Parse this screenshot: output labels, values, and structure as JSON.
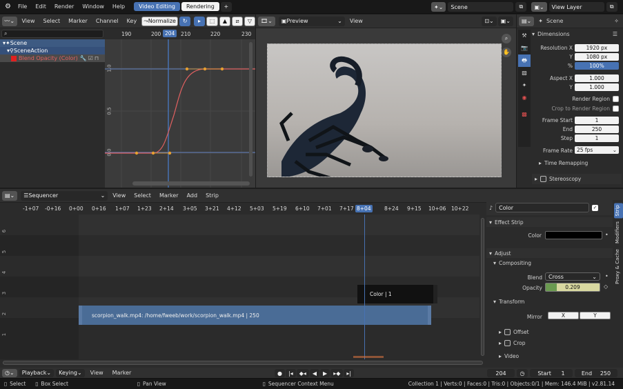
{
  "topbar": {
    "menus": [
      "File",
      "Edit",
      "Render",
      "Window",
      "Help"
    ],
    "workspaces": [
      "Video Editing",
      "Rendering"
    ],
    "scene": "Scene",
    "view_layer": "View Layer"
  },
  "graph_editor": {
    "menus": [
      "View",
      "Select",
      "Marker",
      "Channel",
      "Key"
    ],
    "normalize": "Normalize",
    "ruler": [
      "190",
      "200",
      "204",
      "210",
      "220",
      "230"
    ],
    "current_frame": "204",
    "tree": [
      "Scene",
      "SceneAction",
      "Blend Opacity (Color)"
    ],
    "y_labels": [
      "1.0",
      "0.5",
      "0.0"
    ]
  },
  "preview": {
    "mode": "Preview",
    "view_menu": "View"
  },
  "properties": {
    "scene_label": "Scene",
    "section": "Dimensions",
    "resolution_x_label": "Resolution X",
    "resolution_x": "1920 px",
    "y_label": "Y",
    "resolution_y": "1080 px",
    "pct_label": "%",
    "pct": "100%",
    "aspect_x_label": "Aspect X",
    "aspect_x": "1.000",
    "aspect_y_label": "Y",
    "aspect_y": "1.000",
    "render_region": "Render Region",
    "crop_region": "Crop to Render Region",
    "frame_start_label": "Frame Start",
    "frame_start": "1",
    "end_label": "End",
    "frame_end": "250",
    "step_label": "Step",
    "frame_step": "1",
    "frame_rate_label": "Frame Rate",
    "frame_rate": "25 fps",
    "time_remapping": "Time Remapping",
    "stereoscopy": "Stereoscopy"
  },
  "sequencer": {
    "editor": "Sequencer",
    "menus": [
      "View",
      "Select",
      "Marker",
      "Add",
      "Strip"
    ],
    "ruler": [
      "-1+07",
      "-0+16",
      "0+00",
      "0+16",
      "1+07",
      "1+23",
      "2+14",
      "3+05",
      "3+21",
      "4+12",
      "5+03",
      "5+19",
      "6+10",
      "7+01",
      "7+17",
      "8+04",
      "8+24",
      "9+15",
      "10+06",
      "10+22"
    ],
    "current_time": "8+04",
    "channels": [
      "6",
      "5",
      "4",
      "3",
      "2",
      "1"
    ],
    "color_strip": "Color | 1",
    "movie_strip": "scorpion_walk.mp4: /home/fweeb/work/scorpion_walk.mp4 | 250"
  },
  "strip_panel": {
    "name": "Color",
    "effect_strip": "Effect Strip",
    "color_label": "Color",
    "color_value": "#000000",
    "adjust": "Adjust",
    "compositing": "Compositing",
    "blend_label": "Blend",
    "blend": "Cross",
    "opacity_label": "Opacity",
    "opacity": "0.209",
    "transform": "Transform",
    "mirror_label": "Mirror",
    "mirror_x": "X",
    "mirror_y": "Y",
    "offset": "Offset",
    "crop": "Crop",
    "video": "Video",
    "tabs": [
      "Strip",
      "Modifiers",
      "Proxy & Cache"
    ]
  },
  "timeline": {
    "menus": [
      "Playback",
      "Keying",
      "View",
      "Marker"
    ],
    "current": "204",
    "start_label": "Start",
    "start": "1",
    "end_label": "End",
    "end": "250"
  },
  "status": {
    "select": "Select",
    "box_select": "Box Select",
    "pan_view": "Pan View",
    "context_menu": "Sequencer Context Menu",
    "stats": "Collection 1 | Verts:0 | Faces:0 | Tris:0 | Objects:0/1 | Mem: 146.4 MiB | v2.81.14"
  },
  "colors": {
    "accent": "#4772b3",
    "curve": "#e06060",
    "keyframe": "#e8a030",
    "strip_movie": "#4a6c96",
    "strip_color": "#111111",
    "opacity_bar": "#6a9a50"
  }
}
